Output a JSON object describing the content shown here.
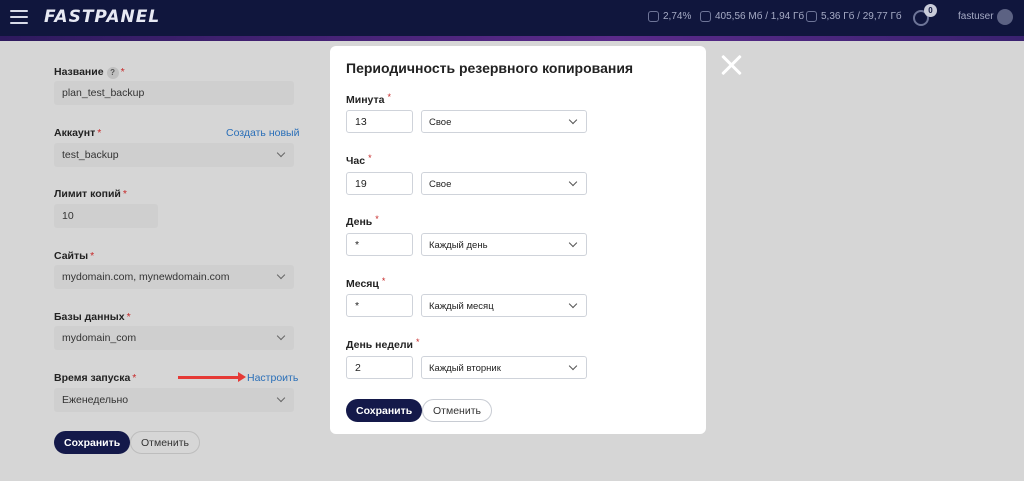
{
  "header": {
    "logo": "FASTPANEL",
    "cpu": "2,74%",
    "ram": "405,56 Мб / 1,94 Гб",
    "disk": "5,36 Гб / 29,77 Гб",
    "tasks_count": "0",
    "username": "fastuser"
  },
  "form": {
    "name_label": "Название",
    "name_help": "?",
    "name_value": "plan_test_backup",
    "account_label": "Аккаунт",
    "account_link": "Создать новый",
    "account_value": "test_backup",
    "limit_label": "Лимит копий",
    "limit_value": "10",
    "sites_label": "Сайты",
    "sites_value": "mydomain.com, mynewdomain.com",
    "db_label": "Базы данных",
    "db_value": "mydomain_com",
    "schedule_label": "Время запуска",
    "schedule_link": "Настроить",
    "schedule_value": "Еженедельно",
    "save_label": "Сохранить",
    "cancel_label": "Отменить",
    "required_mark": "*"
  },
  "modal": {
    "title": "Периодичность резервного копирования",
    "required_mark": "*",
    "fields": [
      {
        "label": "Минута",
        "value": "13",
        "mode": "Свое"
      },
      {
        "label": "Час",
        "value": "19",
        "mode": "Свое"
      },
      {
        "label": "День",
        "value": "*",
        "mode": "Каждый день"
      },
      {
        "label": "Месяц",
        "value": "*",
        "mode": "Каждый месяц"
      },
      {
        "label": "День недели",
        "value": "2",
        "mode": "Каждый вторник"
      }
    ],
    "save_label": "Сохранить",
    "cancel_label": "Отменить"
  }
}
